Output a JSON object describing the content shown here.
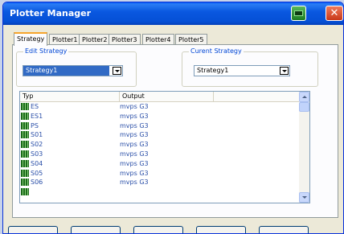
{
  "window": {
    "title": "Plotter Manager"
  },
  "tabs": [
    {
      "label": "Strategy"
    },
    {
      "label": "Plotter1"
    },
    {
      "label": "Plotter2"
    },
    {
      "label": "Plotter3"
    },
    {
      "label": "Plotter4"
    },
    {
      "label": "Plotter5"
    }
  ],
  "edit_strategy": {
    "label": "Edit Strategy",
    "value": "Strategy1"
  },
  "current_strategy": {
    "label": "Curent Strategy",
    "value": "Strategy1"
  },
  "list": {
    "columns": [
      "Typ",
      "Output"
    ],
    "rows": [
      {
        "name": "ES",
        "output": "mvps G3"
      },
      {
        "name": "ES1",
        "output": "mvps G3"
      },
      {
        "name": "PS",
        "output": "mvps G3"
      },
      {
        "name": "S01",
        "output": "mvps G3"
      },
      {
        "name": "S02",
        "output": "mvps G3"
      },
      {
        "name": "S03",
        "output": "mvps G3"
      },
      {
        "name": "S04",
        "output": "mvps G3"
      },
      {
        "name": "S05",
        "output": "mvps G3"
      },
      {
        "name": "S06",
        "output": "mvps G3"
      }
    ]
  },
  "colors": {
    "titlebar": "#0a58e0",
    "selection": "#316ac5",
    "group_label": "#0046d5",
    "row_text": "#2a4fa8",
    "active_tab_accent": "#f6a42c"
  },
  "icons": {
    "titlebar_extra": "printer-icon",
    "close": "close-icon",
    "row": "grid-icon"
  }
}
